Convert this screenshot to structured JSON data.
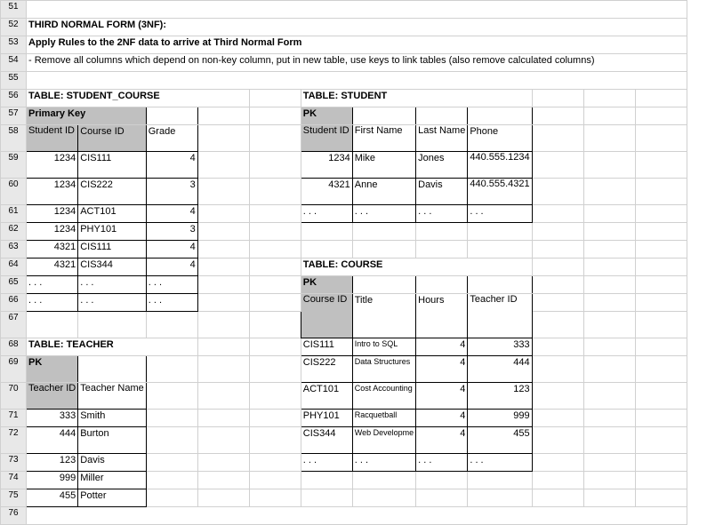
{
  "rows": [
    "51",
    "52",
    "53",
    "54",
    "55",
    "56",
    "57",
    "58",
    "59",
    "60",
    "61",
    "62",
    "63",
    "64",
    "65",
    "66",
    "67",
    "68",
    "69",
    "70",
    "71",
    "72",
    "73",
    "74",
    "75",
    "76"
  ],
  "hdr": {
    "title": "THIRD NORMAL FORM (3NF):",
    "apply": "Apply Rules to the 2NF data to arrive at Third Normal Form",
    "rule": "- Remove all columns which depend on non-key column, put in new table, use keys to link tables (also remove calculated columns)"
  },
  "sc": {
    "title": "TABLE: STUDENT_COURSE",
    "pk": "Primary Key",
    "cols": [
      "Student ID",
      "Course ID",
      "Grade"
    ],
    "rows": [
      [
        "1234",
        "CIS111",
        "4"
      ],
      [
        "1234",
        "CIS222",
        "3"
      ],
      [
        "1234",
        "ACT101",
        "4"
      ],
      [
        "1234",
        "PHY101",
        "3"
      ],
      [
        "4321",
        "CIS111",
        "4"
      ],
      [
        "4321",
        "CIS344",
        "4"
      ],
      [
        ". . .",
        ". . .",
        ". . ."
      ],
      [
        ". . .",
        ". . .",
        ". . ."
      ]
    ]
  },
  "student": {
    "title": "TABLE: STUDENT",
    "pk": "PK",
    "cols": [
      "Student ID",
      "First Name",
      "Last Name",
      "Phone"
    ],
    "rows": [
      [
        "1234",
        "Mike",
        "Jones",
        "440.555.1234"
      ],
      [
        "4321",
        "Anne",
        "Davis",
        "440.555.4321"
      ],
      [
        ". . .",
        ". . .",
        ". . .",
        ". . ."
      ]
    ]
  },
  "teacher": {
    "title": "TABLE: TEACHER",
    "pk": "PK",
    "cols": [
      "Teacher ID",
      "Teacher Name"
    ],
    "rows": [
      [
        "333",
        "Smith"
      ],
      [
        "444",
        "Burton"
      ],
      [
        "123",
        "Davis"
      ],
      [
        "999",
        "Miller"
      ],
      [
        "455",
        "Potter"
      ]
    ]
  },
  "course": {
    "title": "TABLE: COURSE",
    "pk": "PK",
    "cols": [
      "Course ID",
      "Title",
      "Hours",
      "Teacher ID"
    ],
    "rows": [
      [
        "CIS111",
        "Intro to SQL",
        "4",
        "333"
      ],
      [
        "CIS222",
        "Data Structures",
        "4",
        "444"
      ],
      [
        "ACT101",
        "Cost Accounting",
        "4",
        "123"
      ],
      [
        "PHY101",
        "Racquetball",
        "4",
        "999"
      ],
      [
        "CIS344",
        "Web Developme",
        "4",
        "455"
      ],
      [
        ". . .",
        ". . .",
        ". . .",
        ". . ."
      ]
    ]
  }
}
